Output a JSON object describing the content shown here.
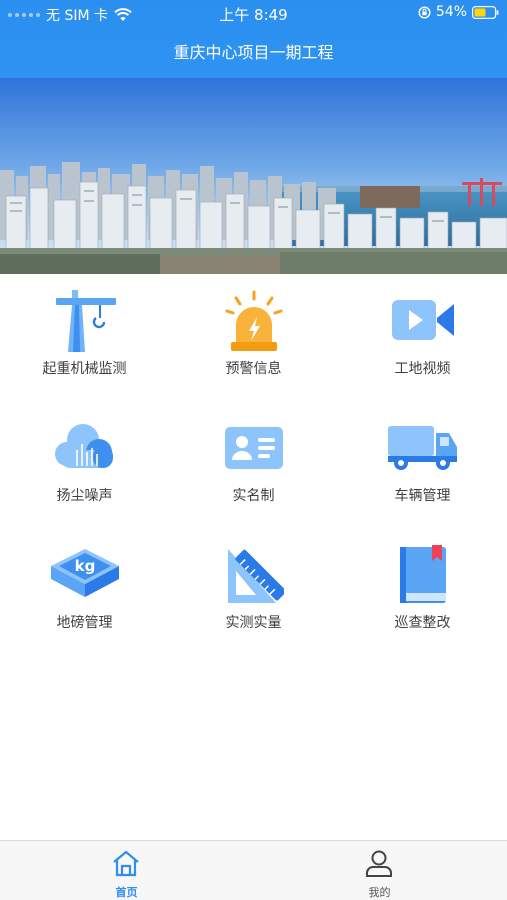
{
  "status_bar": {
    "carrier": "无 SIM 卡",
    "time": "上午 8:49",
    "battery": "54%"
  },
  "header": {
    "title": "重庆中心项目一期工程"
  },
  "banner": {
    "slides": 2,
    "active_slide": 1
  },
  "menu": [
    {
      "label": "起重机械监测",
      "icon": "tower-crane-icon"
    },
    {
      "label": "预警信息",
      "icon": "alarm-light-icon"
    },
    {
      "label": "工地视频",
      "icon": "video-camera-icon"
    },
    {
      "label": "扬尘噪声",
      "icon": "dust-cloud-icon"
    },
    {
      "label": "实名制",
      "icon": "id-card-icon"
    },
    {
      "label": "车辆管理",
      "icon": "truck-icon"
    },
    {
      "label": "地磅管理",
      "icon": "weighbridge-kg-icon"
    },
    {
      "label": "实测实量",
      "icon": "ruler-icon"
    },
    {
      "label": "巡查整改",
      "icon": "inspection-book-icon"
    }
  ],
  "tabbar": {
    "home_label": "首页",
    "mine_label": "我的",
    "active": "home"
  },
  "colors": {
    "primary": "#2f8ef0",
    "icon_light": "#8cc4fb",
    "icon_dark": "#2a7ae8",
    "alert_orange": "#f7a21b"
  }
}
